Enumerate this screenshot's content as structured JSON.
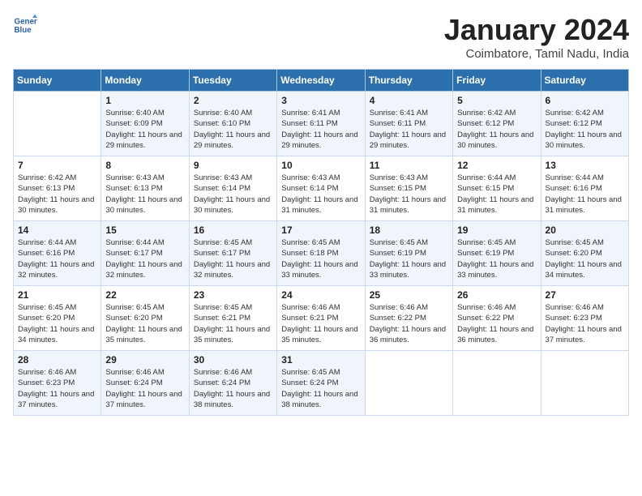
{
  "header": {
    "logo_line1": "General",
    "logo_line2": "Blue",
    "month_title": "January 2024",
    "location": "Coimbatore, Tamil Nadu, India"
  },
  "weekdays": [
    "Sunday",
    "Monday",
    "Tuesday",
    "Wednesday",
    "Thursday",
    "Friday",
    "Saturday"
  ],
  "weeks": [
    [
      {
        "day": "",
        "sunrise": "",
        "sunset": "",
        "daylight": ""
      },
      {
        "day": "1",
        "sunrise": "Sunrise: 6:40 AM",
        "sunset": "Sunset: 6:09 PM",
        "daylight": "Daylight: 11 hours and 29 minutes."
      },
      {
        "day": "2",
        "sunrise": "Sunrise: 6:40 AM",
        "sunset": "Sunset: 6:10 PM",
        "daylight": "Daylight: 11 hours and 29 minutes."
      },
      {
        "day": "3",
        "sunrise": "Sunrise: 6:41 AM",
        "sunset": "Sunset: 6:11 PM",
        "daylight": "Daylight: 11 hours and 29 minutes."
      },
      {
        "day": "4",
        "sunrise": "Sunrise: 6:41 AM",
        "sunset": "Sunset: 6:11 PM",
        "daylight": "Daylight: 11 hours and 29 minutes."
      },
      {
        "day": "5",
        "sunrise": "Sunrise: 6:42 AM",
        "sunset": "Sunset: 6:12 PM",
        "daylight": "Daylight: 11 hours and 30 minutes."
      },
      {
        "day": "6",
        "sunrise": "Sunrise: 6:42 AM",
        "sunset": "Sunset: 6:12 PM",
        "daylight": "Daylight: 11 hours and 30 minutes."
      }
    ],
    [
      {
        "day": "7",
        "sunrise": "Sunrise: 6:42 AM",
        "sunset": "Sunset: 6:13 PM",
        "daylight": "Daylight: 11 hours and 30 minutes."
      },
      {
        "day": "8",
        "sunrise": "Sunrise: 6:43 AM",
        "sunset": "Sunset: 6:13 PM",
        "daylight": "Daylight: 11 hours and 30 minutes."
      },
      {
        "day": "9",
        "sunrise": "Sunrise: 6:43 AM",
        "sunset": "Sunset: 6:14 PM",
        "daylight": "Daylight: 11 hours and 30 minutes."
      },
      {
        "day": "10",
        "sunrise": "Sunrise: 6:43 AM",
        "sunset": "Sunset: 6:14 PM",
        "daylight": "Daylight: 11 hours and 31 minutes."
      },
      {
        "day": "11",
        "sunrise": "Sunrise: 6:43 AM",
        "sunset": "Sunset: 6:15 PM",
        "daylight": "Daylight: 11 hours and 31 minutes."
      },
      {
        "day": "12",
        "sunrise": "Sunrise: 6:44 AM",
        "sunset": "Sunset: 6:15 PM",
        "daylight": "Daylight: 11 hours and 31 minutes."
      },
      {
        "day": "13",
        "sunrise": "Sunrise: 6:44 AM",
        "sunset": "Sunset: 6:16 PM",
        "daylight": "Daylight: 11 hours and 31 minutes."
      }
    ],
    [
      {
        "day": "14",
        "sunrise": "Sunrise: 6:44 AM",
        "sunset": "Sunset: 6:16 PM",
        "daylight": "Daylight: 11 hours and 32 minutes."
      },
      {
        "day": "15",
        "sunrise": "Sunrise: 6:44 AM",
        "sunset": "Sunset: 6:17 PM",
        "daylight": "Daylight: 11 hours and 32 minutes."
      },
      {
        "day": "16",
        "sunrise": "Sunrise: 6:45 AM",
        "sunset": "Sunset: 6:17 PM",
        "daylight": "Daylight: 11 hours and 32 minutes."
      },
      {
        "day": "17",
        "sunrise": "Sunrise: 6:45 AM",
        "sunset": "Sunset: 6:18 PM",
        "daylight": "Daylight: 11 hours and 33 minutes."
      },
      {
        "day": "18",
        "sunrise": "Sunrise: 6:45 AM",
        "sunset": "Sunset: 6:19 PM",
        "daylight": "Daylight: 11 hours and 33 minutes."
      },
      {
        "day": "19",
        "sunrise": "Sunrise: 6:45 AM",
        "sunset": "Sunset: 6:19 PM",
        "daylight": "Daylight: 11 hours and 33 minutes."
      },
      {
        "day": "20",
        "sunrise": "Sunrise: 6:45 AM",
        "sunset": "Sunset: 6:20 PM",
        "daylight": "Daylight: 11 hours and 34 minutes."
      }
    ],
    [
      {
        "day": "21",
        "sunrise": "Sunrise: 6:45 AM",
        "sunset": "Sunset: 6:20 PM",
        "daylight": "Daylight: 11 hours and 34 minutes."
      },
      {
        "day": "22",
        "sunrise": "Sunrise: 6:45 AM",
        "sunset": "Sunset: 6:20 PM",
        "daylight": "Daylight: 11 hours and 35 minutes."
      },
      {
        "day": "23",
        "sunrise": "Sunrise: 6:45 AM",
        "sunset": "Sunset: 6:21 PM",
        "daylight": "Daylight: 11 hours and 35 minutes."
      },
      {
        "day": "24",
        "sunrise": "Sunrise: 6:46 AM",
        "sunset": "Sunset: 6:21 PM",
        "daylight": "Daylight: 11 hours and 35 minutes."
      },
      {
        "day": "25",
        "sunrise": "Sunrise: 6:46 AM",
        "sunset": "Sunset: 6:22 PM",
        "daylight": "Daylight: 11 hours and 36 minutes."
      },
      {
        "day": "26",
        "sunrise": "Sunrise: 6:46 AM",
        "sunset": "Sunset: 6:22 PM",
        "daylight": "Daylight: 11 hours and 36 minutes."
      },
      {
        "day": "27",
        "sunrise": "Sunrise: 6:46 AM",
        "sunset": "Sunset: 6:23 PM",
        "daylight": "Daylight: 11 hours and 37 minutes."
      }
    ],
    [
      {
        "day": "28",
        "sunrise": "Sunrise: 6:46 AM",
        "sunset": "Sunset: 6:23 PM",
        "daylight": "Daylight: 11 hours and 37 minutes."
      },
      {
        "day": "29",
        "sunrise": "Sunrise: 6:46 AM",
        "sunset": "Sunset: 6:24 PM",
        "daylight": "Daylight: 11 hours and 37 minutes."
      },
      {
        "day": "30",
        "sunrise": "Sunrise: 6:46 AM",
        "sunset": "Sunset: 6:24 PM",
        "daylight": "Daylight: 11 hours and 38 minutes."
      },
      {
        "day": "31",
        "sunrise": "Sunrise: 6:45 AM",
        "sunset": "Sunset: 6:24 PM",
        "daylight": "Daylight: 11 hours and 38 minutes."
      },
      {
        "day": "",
        "sunrise": "",
        "sunset": "",
        "daylight": ""
      },
      {
        "day": "",
        "sunrise": "",
        "sunset": "",
        "daylight": ""
      },
      {
        "day": "",
        "sunrise": "",
        "sunset": "",
        "daylight": ""
      }
    ]
  ]
}
